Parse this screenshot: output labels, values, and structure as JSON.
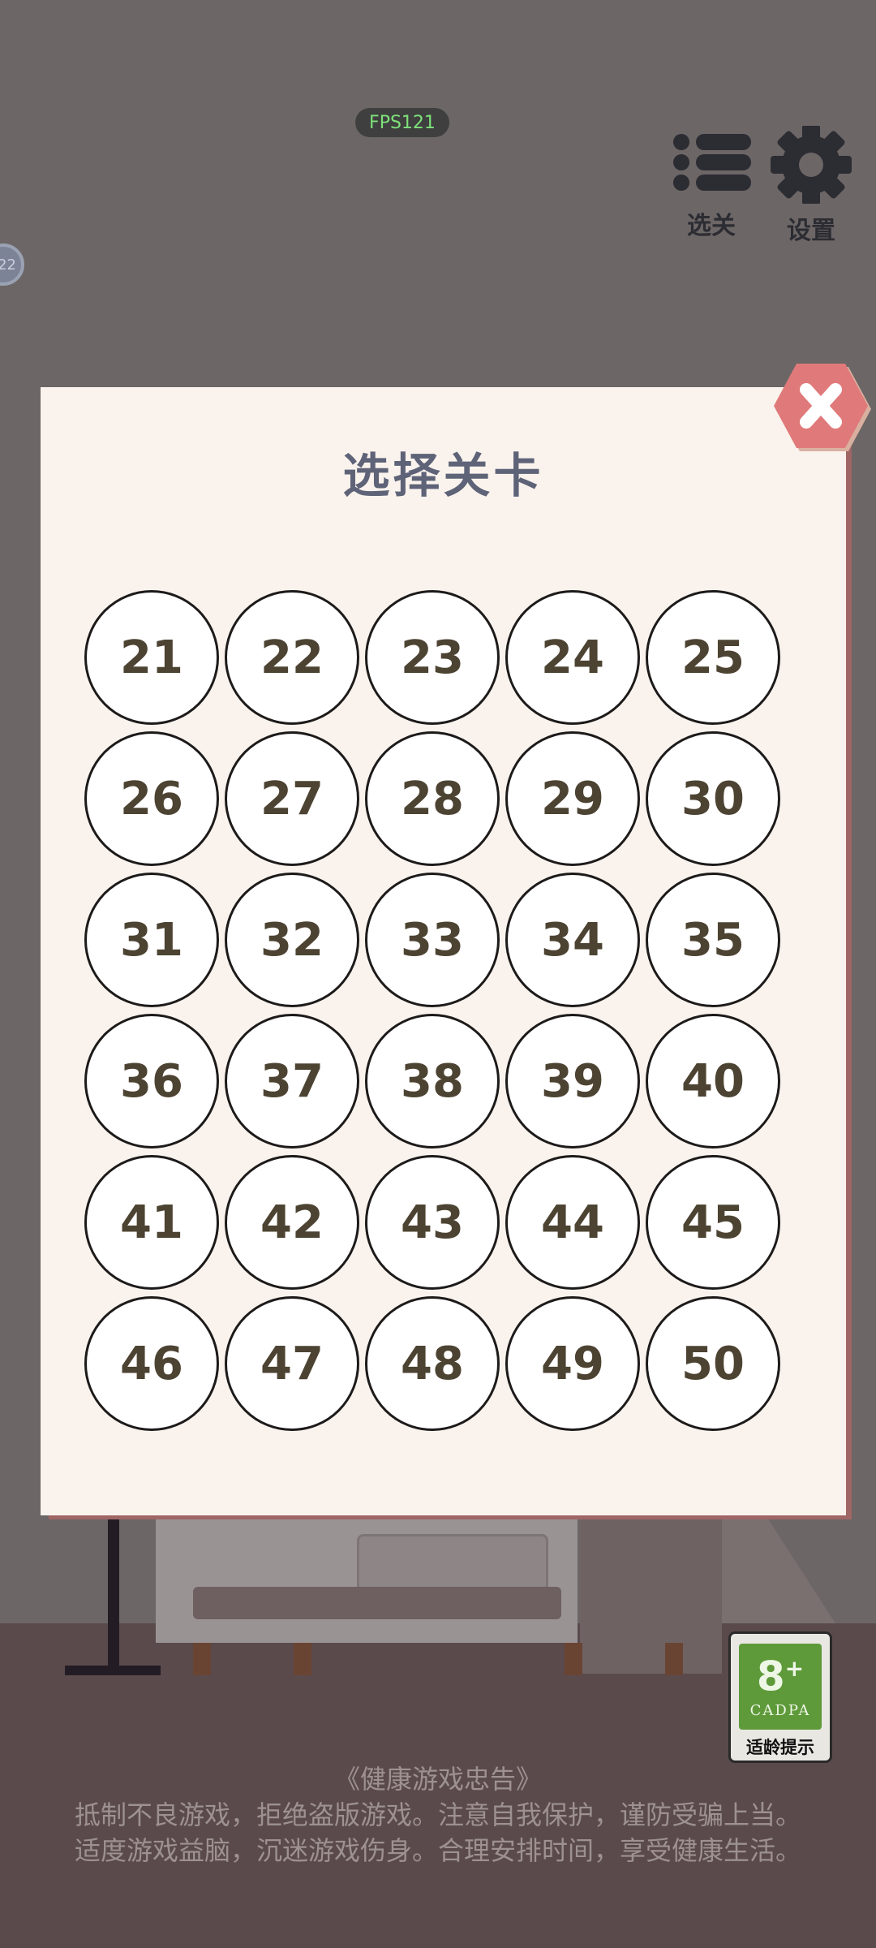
{
  "hud": {
    "fps": "FPS121",
    "level_select_label": "选关",
    "settings_label": "设置",
    "avatar_text": "22"
  },
  "modal": {
    "title": "选择关卡",
    "levels": [
      "21",
      "22",
      "23",
      "24",
      "25",
      "26",
      "27",
      "28",
      "29",
      "30",
      "31",
      "32",
      "33",
      "34",
      "35",
      "36",
      "37",
      "38",
      "39",
      "40",
      "41",
      "42",
      "43",
      "44",
      "45",
      "46",
      "47",
      "48",
      "49",
      "50"
    ]
  },
  "age_rating": {
    "age": "8",
    "plus": "+",
    "org": "CADPA",
    "tip": "适龄提示"
  },
  "notice": {
    "title": "《健康游戏忠告》",
    "line1": "抵制不良游戏，拒绝盗版游戏。注意自我保护，谨防受骗上当。",
    "line2": "适度游戏益脑，沉迷游戏伤身。合理安排时间，享受健康生活。"
  },
  "colors": {
    "modal_bg": "#faf3ed",
    "title": "#5e6378",
    "close_button": "#e07a7a",
    "number": "#4d4332"
  }
}
